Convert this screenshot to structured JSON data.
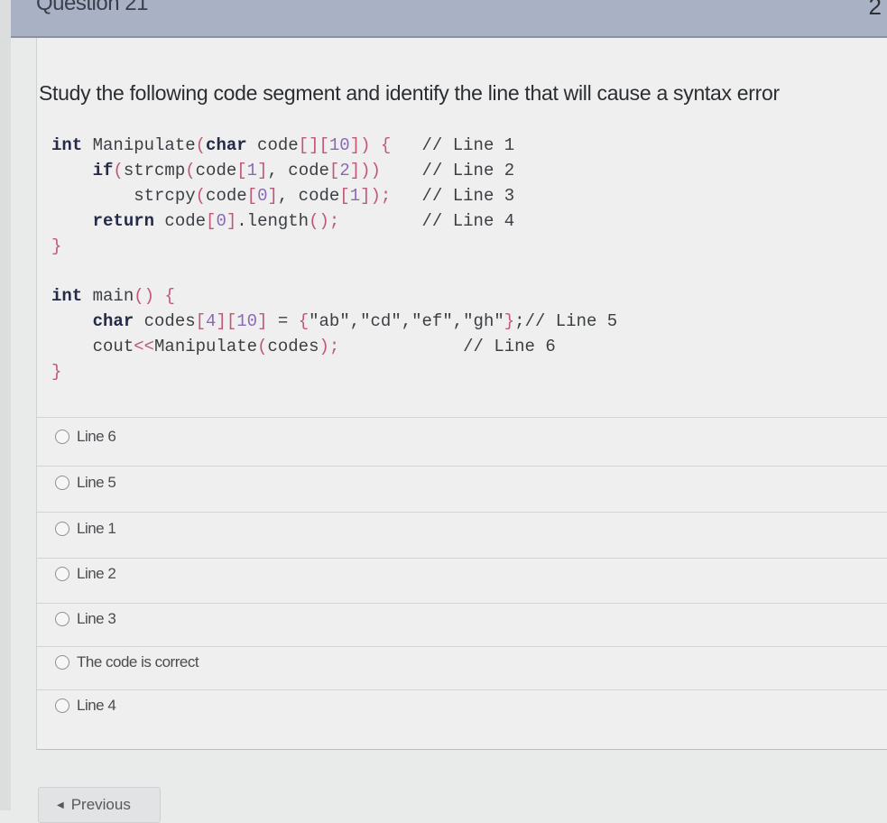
{
  "header": {
    "title": "Question 21",
    "points": "2"
  },
  "question": {
    "prompt": "Study the following code segment and identify the line that will cause a syntax error",
    "code_lines": [
      "int Manipulate(char code[][10]) {   // Line 1",
      "    if(strcmp(code[1], code[2]))    // Line 2",
      "        strcpy(code[0], code[1]);   // Line 3",
      "    return code[0].length();        // Line 4",
      "}",
      "",
      "int main() {",
      "    char codes[4][10] = {\"ab\",\"cd\",\"ef\",\"gh\"};// Line 5",
      "    cout<<Manipulate(codes);            // Line 6",
      "}"
    ]
  },
  "options": [
    {
      "label": "Line 6",
      "selected": false
    },
    {
      "label": "Line 5",
      "selected": false
    },
    {
      "label": "Line 1",
      "selected": false
    },
    {
      "label": "Line 2",
      "selected": false
    },
    {
      "label": "Line 3",
      "selected": false
    },
    {
      "label": "The code is correct",
      "selected": false
    },
    {
      "label": "Line 4",
      "selected": false
    }
  ],
  "nav": {
    "previous_label": "Previous",
    "previous_icon": "triangle-left-icon"
  }
}
